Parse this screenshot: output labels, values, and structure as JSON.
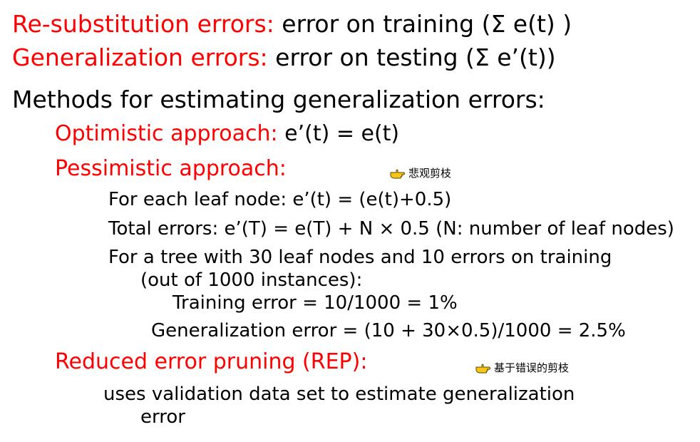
{
  "definitions": {
    "resub_label": "Re-substitution errors:",
    "resub_text": "error on training (Σ e(t) )",
    "gen_label": "Generalization errors:",
    "gen_text": "error on testing (Σ e’(t))"
  },
  "methods_heading": "Methods for estimating generalization errors:",
  "optimistic": {
    "label": "Optimistic approach:",
    "formula": "e’(t) = e(t)"
  },
  "pessimistic": {
    "label": "Pessimistic approach:",
    "note": "悲观剪枝",
    "leaf_rule": "For each leaf node: e’(t) = (e(t)+0.5)",
    "total_rule": "Total errors: e’(T) = e(T) + N × 0.5 (N: number of leaf nodes)",
    "example_line1": "For a tree with 30 leaf nodes and 10 errors on training",
    "example_line2": "(out of 1000 instances):",
    "training_error": "Training error = 10/1000 = 1%",
    "generalization_error": "Generalization error = (10 + 30×0.5)/1000 = 2.5%"
  },
  "rep": {
    "label": "Reduced error pruning (REP):",
    "note": "基于错误的剪枝",
    "desc_line1": "uses validation data set to estimate generalization",
    "desc_line2": "error"
  },
  "colors": {
    "accent": "#ff0000",
    "text": "#000000",
    "note_icon": "#f5c518"
  },
  "icons": {
    "note_marker": "pointing-hand-icon"
  }
}
